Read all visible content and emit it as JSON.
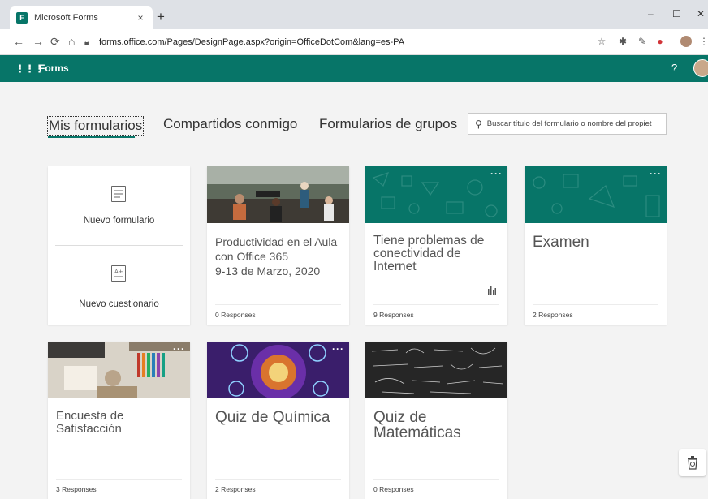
{
  "browser": {
    "tab_title": "Microsoft Forms",
    "tab_close": "×",
    "new_tab": "+",
    "window_controls": [
      "–",
      "☐",
      "✕"
    ],
    "url": "forms.office.com/Pages/DesignPage.aspx?origin=OfficeDotCom&lang=es-PA"
  },
  "appbar": {
    "name": "Forms",
    "help": "?"
  },
  "tabs": {
    "mine": "Mis formularios",
    "shared": "Compartidos conmigo",
    "groups": "Formularios de grupos"
  },
  "search": {
    "placeholder": "Buscar título del formulario o nombre del propiet"
  },
  "new": {
    "form_label": "Nuevo formulario",
    "quiz_label": "Nuevo cuestionario"
  },
  "cards": [
    {
      "title": "Productividad en el Aula con Office 365 9-13 de Marzo, 2020",
      "line1": "Productividad en el Aula",
      "line2": "con Office 365",
      "line3": "9-13 de Marzo, 2020",
      "responses": "0 Responses",
      "image": "office-photo"
    },
    {
      "title": "Tiene problemas de conectividad de Internet",
      "line1": "Tiene problemas de",
      "line2": "conectividad de",
      "line3": "Internet",
      "responses": "9 Responses",
      "image": "teal-pattern"
    },
    {
      "title": "Examen",
      "responses": "2 Responses",
      "image": "teal-pattern"
    },
    {
      "title": "Encuesta de Satisfacción",
      "line1": "Encuesta de",
      "line2": "Satisfacción",
      "responses": "3 Responses",
      "image": "design-desk-photo"
    },
    {
      "title": "Quiz de Química",
      "responses": "2 Responses",
      "image": "purple-flower"
    },
    {
      "title": "Quiz de Matemáticas",
      "line1": "Quiz de",
      "line2": "Matemáticas",
      "responses": "0 Responses",
      "image": "chalkboard-math"
    }
  ],
  "colors": {
    "brand": "#077568",
    "background": "#f3f3f3"
  },
  "icons": [
    "waffle-icon",
    "search-icon",
    "more-icon",
    "chart-icon",
    "recycle-bin-icon",
    "lock-icon",
    "star-icon"
  ]
}
